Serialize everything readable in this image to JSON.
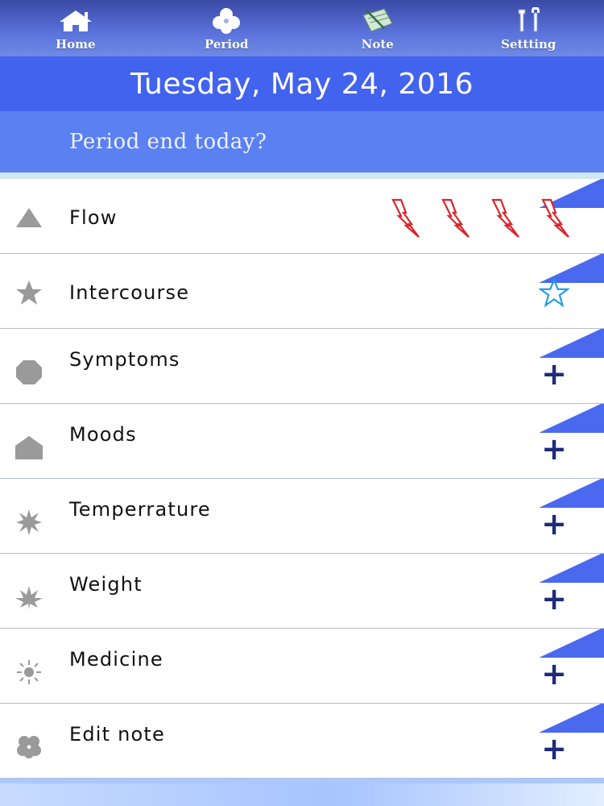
{
  "nav": {
    "items": [
      {
        "label": "Home",
        "icon": "home-icon"
      },
      {
        "label": "Period",
        "icon": "flower-icon"
      },
      {
        "label": "Note",
        "icon": "notepad-icon"
      },
      {
        "label": "Settting",
        "icon": "tools-icon"
      }
    ]
  },
  "date": {
    "text": "Tuesday, May 24, 2016"
  },
  "period": {
    "question": "Period end today?"
  },
  "list": {
    "items": [
      {
        "label": "Flow",
        "icon": "triangle-icon",
        "action": "flow-bolts",
        "flow_levels": 4
      },
      {
        "label": "Intercourse",
        "icon": "star-icon",
        "action": "star-outline-icon"
      },
      {
        "label": "Symptoms",
        "icon": "octagon-icon",
        "action": "+"
      },
      {
        "label": "Moods",
        "icon": "house-shape-icon",
        "action": "+"
      },
      {
        "label": "Temperrature",
        "icon": "starburst-icon",
        "action": "+"
      },
      {
        "label": "Weight",
        "icon": "leaf-icon",
        "action": "+"
      },
      {
        "label": "Medicine",
        "icon": "sun-icon",
        "action": "+"
      },
      {
        "label": "Edit note",
        "icon": "clover-icon",
        "action": "+"
      }
    ]
  },
  "colors": {
    "nav_bg": "#4a5fcc",
    "date_bg": "#4263ee",
    "period_bg": "#5a80f2",
    "row_corner": "#4a69ee",
    "plus": "#1e2b7a",
    "bolt": "#d9262b",
    "star_outline": "#1e9ae6",
    "lead_icon": "#9a9a9a"
  }
}
